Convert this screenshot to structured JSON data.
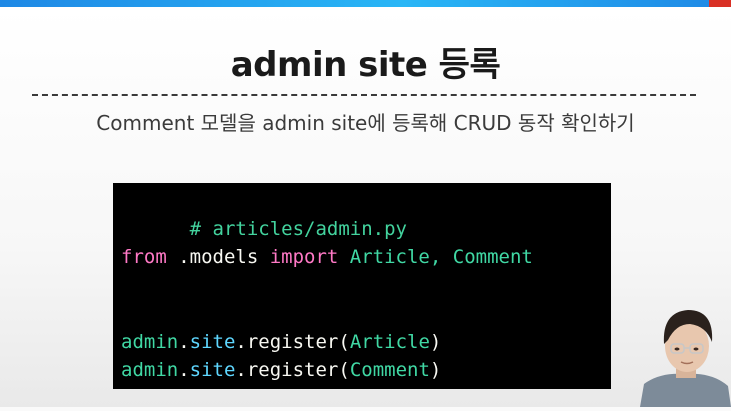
{
  "slide": {
    "title": "admin site 등록",
    "subtitle": "Comment 모델을 admin site에 등록해 CRUD 동작 확인하기"
  },
  "code": {
    "line1": "# articles/admin.py",
    "line2": {
      "from": "from",
      "module": " .models ",
      "import": "import",
      "names": " Article, ",
      "comment": "Comment"
    },
    "line3": {
      "admin": "admin",
      "dot1": ".",
      "site": "site",
      "call": ".register(",
      "arg": "Article",
      "close": ")"
    },
    "line4": {
      "admin": "admin",
      "dot1": ".",
      "site": "site",
      "call": ".register(",
      "arg": "Comment",
      "close": ")"
    }
  },
  "colors": {
    "top_bar": "#1e88e5",
    "code_bg": "#000000",
    "comment": "#43d39e",
    "keyword": "#ff79c6",
    "name": "#40d8a4"
  },
  "icons": {
    "presenter": "presenter-webcam-thumbnail"
  }
}
